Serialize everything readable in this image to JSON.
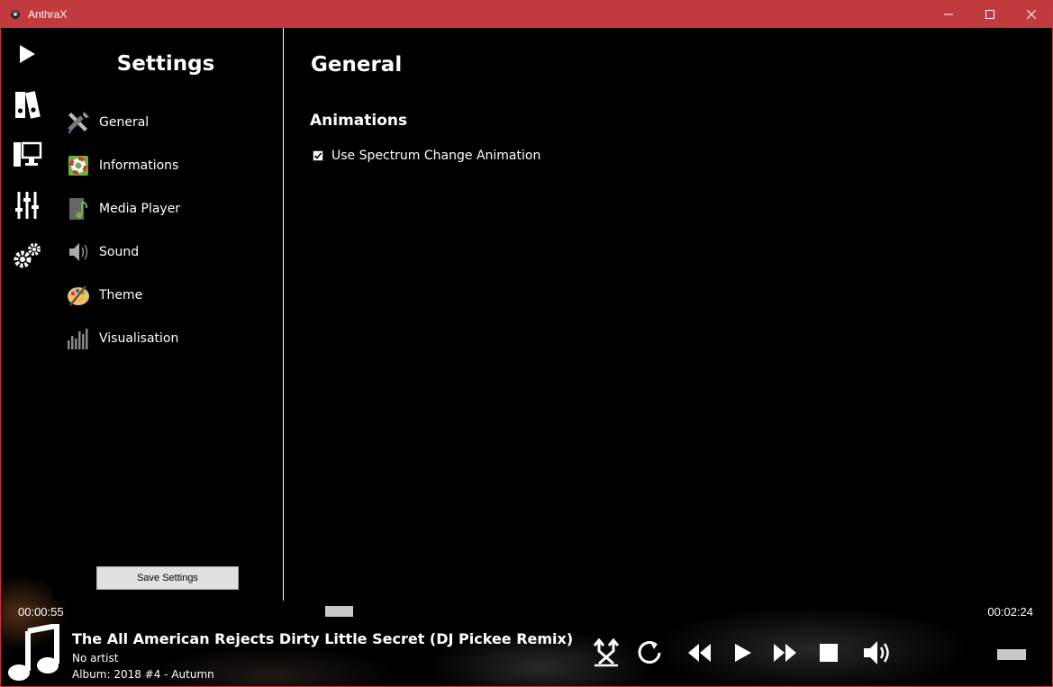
{
  "window": {
    "title": "AnthraX"
  },
  "settings": {
    "title": "Settings",
    "nav": [
      {
        "label": "General",
        "icon": "tools-icon"
      },
      {
        "label": "Informations",
        "icon": "lifebuoy-icon"
      },
      {
        "label": "Media Player",
        "icon": "music-file-icon"
      },
      {
        "label": "Sound",
        "icon": "speaker-icon"
      },
      {
        "label": "Theme",
        "icon": "palette-icon"
      },
      {
        "label": "Visualisation",
        "icon": "equalizer-bars-icon"
      }
    ],
    "save_label": "Save Settings"
  },
  "general": {
    "title": "General",
    "section": "Animations",
    "option_label": "Use Spectrum Change Animation",
    "option_checked": true
  },
  "player": {
    "elapsed": "00:00:55",
    "duration": "00:02:24",
    "progress": 0.38,
    "track": "The All American Rejects  Dirty Little Secret (DJ Pickee Remix)",
    "artist": "No artist",
    "album": "Album: 2018 #4 - Autumn"
  },
  "colors": {
    "titlebar": "#c13a3d",
    "background": "#000000",
    "text": "#ffffff"
  }
}
